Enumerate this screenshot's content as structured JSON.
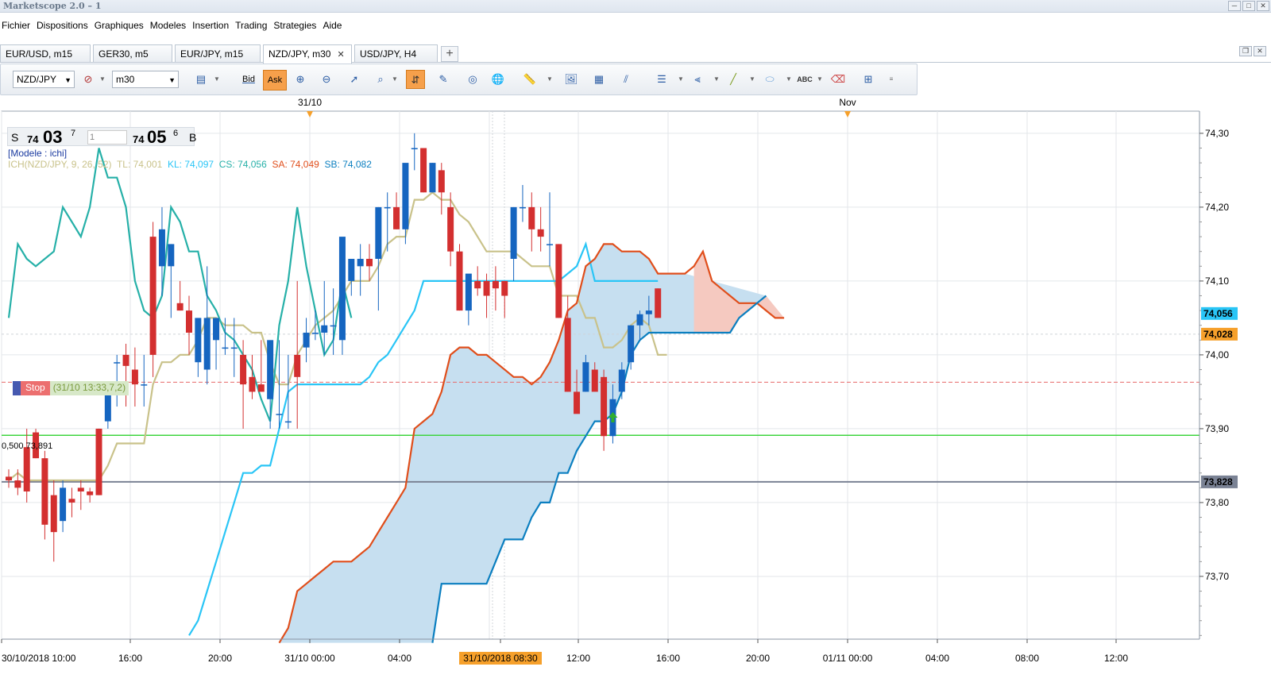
{
  "window": {
    "title": "Marketscope 2.0 – 1",
    "buttons": [
      "─",
      "□",
      "✕"
    ]
  },
  "menu": [
    "Fichier",
    "Dispositions",
    "Graphiques",
    "Modeles",
    "Insertion",
    "Trading",
    "Strategies",
    "Aide"
  ],
  "tabs": [
    {
      "label": "EUR/USD, m15"
    },
    {
      "label": "GER30, m5"
    },
    {
      "label": "EUR/JPY, m15"
    },
    {
      "label": "NZD/JPY, m30",
      "close": "✕"
    },
    {
      "label": "USD/JPY, H4"
    }
  ],
  "tab_add": "+",
  "toolbar": {
    "symbol": "NZD/JPY",
    "timeframe": "m30",
    "bid_label": "Bid",
    "ask_label": "Ask",
    "icons": [
      "chart-type-icon",
      "crosshair-icon",
      "zoom-in-icon",
      "zoom-out-icon",
      "cursor-icon",
      "zoom-area-icon",
      "autoscroll-icon",
      "properties-icon",
      "broadcast-icon",
      "globe-icon",
      "ruler-icon",
      "image-icon",
      "indicator-icon",
      "parallel-lines-icon",
      "horizontal-lines-icon",
      "fan-icon",
      "trendline-icon",
      "ellipse-icon",
      "text-icon",
      "eraser-icon",
      "hierarchy-icon",
      "overflow-icon"
    ]
  },
  "quote": {
    "sell_label": "S",
    "sell_prefix": "74",
    "sell_big": "03",
    "sell_sup": "7",
    "amount": "1",
    "buy_prefix": "74",
    "buy_big": "05",
    "buy_sup": "6",
    "buy_label": "B"
  },
  "indicator": {
    "model": "[Modele : ichi]",
    "name": "ICH(NZD/JPY, 9, 26, 52)",
    "tl": "TL: 74,001",
    "kl": "KL: 74,097",
    "cs": "CS: 74,056",
    "sa": "SA: 74,049",
    "sb": "SB: 74,082"
  },
  "stop_order": {
    "label": "Stop",
    "info": "(31/10 13:33,7,2)",
    "price": 73.963
  },
  "fib_label": "0,500 73,891",
  "colors": {
    "bull": "#1565c0",
    "bear": "#d32f2f",
    "tenkan": "#c9c28a",
    "kijun": "#29c5f6",
    "chikou": "#26b0a8",
    "span_a": "#e04e1b",
    "span_b": "#0b7fc0",
    "cloud": "#c6dff0",
    "cloud_bear": "#f5c9c0",
    "green_line": "#3fd43f",
    "gray_line": "#7a8294",
    "stop_line": "#e86a6a"
  },
  "chart_data": {
    "type": "candlestick",
    "symbol": "NZD/JPY",
    "timeframe": "m30",
    "ylim": [
      73.615,
      74.33
    ],
    "y_ticks": [
      "74,30",
      "74,20",
      "74,10",
      "74,00",
      "73,90",
      "73,80",
      "73,70"
    ],
    "x_ticks": [
      "30/10/2018 10:00",
      "16:00",
      "20:00",
      "31/10 00:00",
      "04:00",
      "31/10/2018 08:30",
      "12:00",
      "16:00",
      "20:00",
      "01/11 00:00",
      "04:00",
      "08:00",
      "12:00"
    ],
    "top_labels": [
      "31/10",
      "Nov"
    ],
    "price_labels": [
      {
        "text": "74,056",
        "value": 74.056,
        "color": "#29c5f6"
      },
      {
        "text": "74,028",
        "value": 74.028,
        "color": "#f6a02b"
      },
      {
        "text": "73,828",
        "value": 73.828,
        "color": "#7a8294"
      }
    ],
    "horizontal_levels": {
      "green": 73.891,
      "gray": 73.828,
      "stop": 73.963
    },
    "candles": [
      [
        73.835,
        73.845,
        73.82,
        73.83
      ],
      [
        73.83,
        73.845,
        73.81,
        73.82
      ],
      [
        73.875,
        73.9,
        73.8,
        73.815
      ],
      [
        73.895,
        73.9,
        73.86,
        73.86
      ],
      [
        73.86,
        73.87,
        73.75,
        73.77
      ],
      [
        73.81,
        73.83,
        73.72,
        73.76
      ],
      [
        73.775,
        73.83,
        73.76,
        73.82
      ],
      [
        73.805,
        73.82,
        73.78,
        73.8
      ],
      [
        73.82,
        73.83,
        73.79,
        73.815
      ],
      [
        73.815,
        73.82,
        73.8,
        73.81
      ],
      [
        73.9,
        73.9,
        73.81,
        73.81
      ],
      [
        73.91,
        73.95,
        73.9,
        73.95
      ],
      [
        73.99,
        74.0,
        73.93,
        73.99
      ],
      [
        74.0,
        74.015,
        73.93,
        73.985
      ],
      [
        73.98,
        74.01,
        73.93,
        73.96
      ],
      [
        73.96,
        74.0,
        73.93,
        73.96
      ],
      [
        74.16,
        74.18,
        73.97,
        74.0
      ],
      [
        74.12,
        74.2,
        74.08,
        74.17
      ],
      [
        74.12,
        74.15,
        74.05,
        74.15
      ],
      [
        74.07,
        74.1,
        74.06,
        74.06
      ],
      [
        74.06,
        74.08,
        74.0,
        74.03
      ],
      [
        73.99,
        74.02,
        73.97,
        74.05
      ],
      [
        73.98,
        74.12,
        73.96,
        74.05
      ],
      [
        74.02,
        74.05,
        73.98,
        74.05
      ],
      [
        74.01,
        74.05,
        74.0,
        74.01
      ],
      [
        74.01,
        74.05,
        73.97,
        74.01
      ],
      [
        74.0,
        74.02,
        73.9,
        73.96
      ],
      [
        73.97,
        74.0,
        73.94,
        73.95
      ],
      [
        73.96,
        74.02,
        73.95,
        73.95
      ],
      [
        73.94,
        74.01,
        73.9,
        74.02
      ],
      [
        73.92,
        74.02,
        73.9,
        73.92
      ],
      [
        73.91,
        74.0,
        73.9,
        73.91
      ],
      [
        74.0,
        74.1,
        73.9,
        73.97
      ],
      [
        74.01,
        74.05,
        73.99,
        74.03
      ],
      [
        74.03,
        74.06,
        74.02,
        74.03
      ],
      [
        74.03,
        74.1,
        74.0,
        74.04
      ],
      [
        74.04,
        74.09,
        74.0,
        74.04
      ],
      [
        74.02,
        74.15,
        74.0,
        74.16
      ],
      [
        74.1,
        74.12,
        74.08,
        74.13
      ],
      [
        74.12,
        74.15,
        74.08,
        74.13
      ],
      [
        74.13,
        74.15,
        74.1,
        74.12
      ],
      [
        74.13,
        74.2,
        74.06,
        74.2
      ],
      [
        74.2,
        74.22,
        74.14,
        74.2
      ],
      [
        74.2,
        74.22,
        74.17,
        74.17
      ],
      [
        74.17,
        74.23,
        74.15,
        74.26
      ],
      [
        74.28,
        74.3,
        74.25,
        74.28
      ],
      [
        74.28,
        74.28,
        74.22,
        74.22
      ],
      [
        74.22,
        74.26,
        74.22,
        74.26
      ],
      [
        74.25,
        74.26,
        74.19,
        74.22
      ],
      [
        74.2,
        74.22,
        74.12,
        74.14
      ],
      [
        74.14,
        74.15,
        74.06,
        74.06
      ],
      [
        74.06,
        74.1,
        74.04,
        74.11
      ],
      [
        74.1,
        74.12,
        74.08,
        74.09
      ],
      [
        74.1,
        74.11,
        74.05,
        74.08
      ],
      [
        74.1,
        74.12,
        74.06,
        74.09
      ],
      [
        74.1,
        74.1,
        74.05,
        74.08
      ],
      [
        74.13,
        74.2,
        74.1,
        74.2
      ],
      [
        74.2,
        74.23,
        74.18,
        74.2
      ],
      [
        74.2,
        74.22,
        74.14,
        74.17
      ],
      [
        74.17,
        74.2,
        74.14,
        74.16
      ],
      [
        74.15,
        74.22,
        74.12,
        74.15
      ],
      [
        74.15,
        74.15,
        74.05,
        74.05
      ],
      [
        74.05,
        74.08,
        73.95,
        73.95
      ],
      [
        73.95,
        73.98,
        73.93,
        73.92
      ],
      [
        73.95,
        74.0,
        73.95,
        73.99
      ],
      [
        73.98,
        73.99,
        73.96,
        73.95
      ],
      [
        73.97,
        73.98,
        73.87,
        73.89
      ],
      [
        73.89,
        73.96,
        73.88,
        73.94
      ],
      [
        73.95,
        73.99,
        73.94,
        73.98
      ],
      [
        73.99,
        74.04,
        73.98,
        74.04
      ],
      [
        74.04,
        74.06,
        74.02,
        74.055
      ],
      [
        74.055,
        74.08,
        74.04,
        74.06
      ],
      [
        74.09,
        74.09,
        74.05,
        74.05
      ]
    ],
    "series": [
      {
        "name": "TL",
        "values": [
          73.83,
          73.84,
          73.83,
          73.83,
          73.83,
          73.83,
          73.83,
          73.83,
          73.83,
          73.83,
          73.83,
          73.85,
          73.88,
          73.88,
          73.88,
          73.88,
          73.96,
          73.99,
          73.99,
          74.0,
          74.0,
          74.02,
          74.05,
          74.05,
          74.04,
          74.04,
          74.04,
          74.03,
          74.03,
          73.99,
          73.96,
          73.96,
          74.0,
          74.02,
          74.04,
          74.05,
          74.06,
          74.08,
          74.1,
          74.1,
          74.1,
          74.12,
          74.15,
          74.16,
          74.16,
          74.21,
          74.21,
          74.22,
          74.21,
          74.21,
          74.19,
          74.18,
          74.16,
          74.14,
          74.14,
          74.14,
          74.14,
          74.13,
          74.12,
          74.12,
          74.12,
          74.08,
          74.08,
          74.08,
          74.05,
          74.05,
          74.01,
          74.01,
          74.02,
          74.04,
          74.05,
          74.04,
          74.0,
          74.0
        ]
      },
      {
        "name": "KL",
        "values": [
          73.62,
          73.64,
          73.68,
          73.72,
          73.76,
          73.8,
          73.84,
          73.84,
          73.85,
          73.85,
          73.9,
          73.95,
          73.96,
          73.96,
          73.96,
          73.96,
          73.96,
          73.96,
          73.96,
          73.96,
          73.97,
          73.99,
          74.0,
          74.02,
          74.04,
          74.06,
          74.1,
          74.1,
          74.1,
          74.1,
          74.1,
          74.1,
          74.1,
          74.1,
          74.1,
          74.1,
          74.1,
          74.1,
          74.1,
          74.1,
          74.1,
          74.1,
          74.11,
          74.12,
          74.15,
          74.1,
          74.1,
          74.1,
          74.1,
          74.1,
          74.1,
          74.1,
          74.1
        ]
      },
      {
        "name": "CS",
        "values": [
          74.05,
          74.15,
          74.13,
          74.12,
          74.13,
          74.14,
          74.2,
          74.18,
          74.16,
          74.2,
          74.28,
          74.24,
          74.24,
          74.2,
          74.1,
          74.06,
          74.05,
          74.08,
          74.2,
          74.18,
          74.14,
          74.14,
          74.08,
          74.06,
          74.03,
          74.02,
          74.0,
          73.98,
          73.94,
          73.91,
          74.04,
          74.1,
          74.2,
          74.12,
          74.06,
          74.0,
          74.02,
          74.1,
          74.05
        ]
      },
      {
        "name": "SA",
        "values": [
          73.61,
          73.63,
          73.68,
          73.69,
          73.7,
          73.71,
          73.72,
          73.72,
          73.72,
          73.73,
          73.74,
          73.76,
          73.78,
          73.8,
          73.82,
          73.9,
          73.91,
          73.92,
          73.95,
          74.0,
          74.01,
          74.01,
          74.0,
          74.0,
          73.99,
          73.98,
          73.97,
          73.97,
          73.96,
          73.97,
          73.99,
          74.02,
          74.06,
          74.07,
          74.12,
          74.13,
          74.15,
          74.15,
          74.14,
          74.14,
          74.14,
          74.13,
          74.11,
          74.11,
          74.11,
          74.11,
          74.12,
          74.14,
          74.1,
          74.09,
          74.08,
          74.07,
          74.07,
          74.07,
          74.06,
          74.05,
          74.05
        ]
      },
      {
        "name": "SB",
        "values": [
          73.61,
          73.69,
          73.69,
          73.69,
          73.69,
          73.69,
          73.69,
          73.72,
          73.75,
          73.75,
          73.75,
          73.78,
          73.8,
          73.8,
          73.84,
          73.84,
          73.87,
          73.89,
          73.91,
          73.91,
          73.92,
          73.95,
          74.0,
          74.02,
          74.03,
          74.03,
          74.03,
          74.03,
          74.03,
          74.03,
          74.03,
          74.03,
          74.03,
          74.03,
          74.05,
          74.06,
          74.07,
          74.08
        ]
      }
    ]
  }
}
